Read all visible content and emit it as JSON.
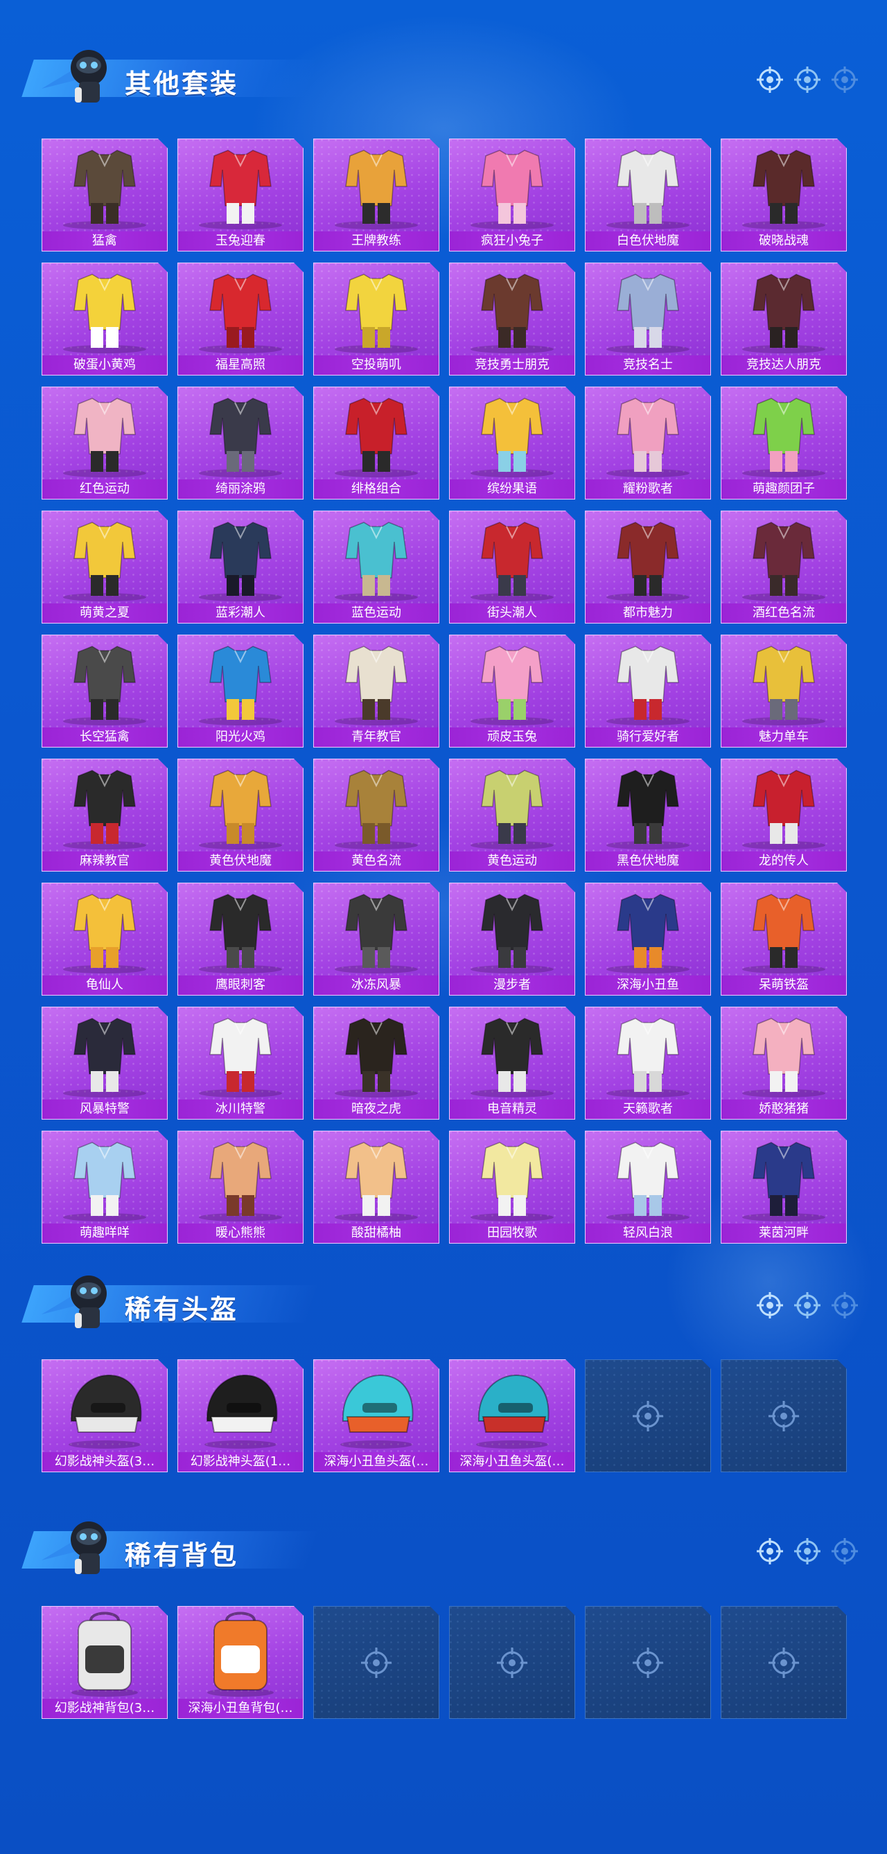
{
  "colors": {
    "background": "#0a5fd6",
    "card_purple": "#a342e3",
    "label_purple": "#9b24d6",
    "empty_slot": "#1f4b8e",
    "banner_blue": "#3fa8ff"
  },
  "sections": [
    {
      "title": "其他套装",
      "items": [
        {
          "label": "猛禽",
          "icon": "outfit-icon",
          "palette": [
            "#5b4a3a",
            "#3a2e26"
          ]
        },
        {
          "label": "玉兔迎春",
          "icon": "outfit-icon",
          "palette": [
            "#d8283a",
            "#f2f2f2"
          ]
        },
        {
          "label": "王牌教练",
          "icon": "outfit-icon",
          "palette": [
            "#e8a23a",
            "#2c2c2c"
          ]
        },
        {
          "label": "疯狂小兔子",
          "icon": "outfit-icon",
          "palette": [
            "#f07ab0",
            "#f4c6dc"
          ]
        },
        {
          "label": "白色伏地魔",
          "icon": "outfit-icon",
          "palette": [
            "#e8e8e8",
            "#bdbdbd"
          ]
        },
        {
          "label": "破晓战魂",
          "icon": "outfit-icon",
          "palette": [
            "#5a2a2a",
            "#2a2a2a"
          ]
        },
        {
          "label": "破蛋小黄鸡",
          "icon": "outfit-icon",
          "palette": [
            "#f4d23a",
            "#ffffff"
          ]
        },
        {
          "label": "福星高照",
          "icon": "outfit-icon",
          "palette": [
            "#d8282e",
            "#9a1a1f"
          ]
        },
        {
          "label": "空投萌叽",
          "icon": "outfit-icon",
          "palette": [
            "#f2d43e",
            "#c9a72a"
          ]
        },
        {
          "label": "竞技勇士朋克",
          "icon": "outfit-icon",
          "palette": [
            "#6b3a2e",
            "#3b2a26"
          ]
        },
        {
          "label": "竞技名士",
          "icon": "outfit-icon",
          "palette": [
            "#9aaed6",
            "#d8d8e8"
          ]
        },
        {
          "label": "竞技达人朋克",
          "icon": "outfit-icon",
          "palette": [
            "#5b2a30",
            "#2a2222"
          ]
        },
        {
          "label": "红色运动",
          "icon": "outfit-icon",
          "palette": [
            "#f0b4c4",
            "#2a2a2a"
          ]
        },
        {
          "label": "绮丽涂鸦",
          "icon": "outfit-icon",
          "palette": [
            "#3a3a4a",
            "#6a6a7a"
          ]
        },
        {
          "label": "绯格组合",
          "icon": "outfit-icon",
          "palette": [
            "#c8202a",
            "#2a2a2a"
          ]
        },
        {
          "label": "缤纷果语",
          "icon": "outfit-icon",
          "palette": [
            "#f4c03a",
            "#8ad0e6"
          ]
        },
        {
          "label": "耀粉歌者",
          "icon": "outfit-icon",
          "palette": [
            "#f0a0c0",
            "#e6c8d8"
          ]
        },
        {
          "label": "萌趣颜团子",
          "icon": "outfit-icon",
          "palette": [
            "#7ed04a",
            "#f2a0c0"
          ]
        },
        {
          "label": "萌黄之夏",
          "icon": "outfit-icon",
          "palette": [
            "#f2c83a",
            "#2a2a2a"
          ]
        },
        {
          "label": "蓝彩潮人",
          "icon": "outfit-icon",
          "palette": [
            "#2a3a5a",
            "#1a1a2a"
          ]
        },
        {
          "label": "蓝色运动",
          "icon": "outfit-icon",
          "palette": [
            "#4ac0d0",
            "#c8b890"
          ]
        },
        {
          "label": "街头潮人",
          "icon": "outfit-icon",
          "palette": [
            "#c8282e",
            "#3a3a4a"
          ]
        },
        {
          "label": "都市魅力",
          "icon": "outfit-icon",
          "palette": [
            "#8a2a2a",
            "#2a2a2a"
          ]
        },
        {
          "label": "酒红色名流",
          "icon": "outfit-icon",
          "palette": [
            "#6a2a3a",
            "#3a2a2a"
          ]
        },
        {
          "label": "长空猛禽",
          "icon": "outfit-icon",
          "palette": [
            "#4a4a4a",
            "#2a2a2a"
          ]
        },
        {
          "label": "阳光火鸡",
          "icon": "outfit-icon",
          "palette": [
            "#2a8ad8",
            "#f2c83a"
          ]
        },
        {
          "label": "青年教官",
          "icon": "outfit-icon",
          "palette": [
            "#e8e0d0",
            "#4a3a2a"
          ]
        },
        {
          "label": "顽皮玉兔",
          "icon": "outfit-icon",
          "palette": [
            "#f4a0c8",
            "#9ad06a"
          ]
        },
        {
          "label": "骑行爱好者",
          "icon": "outfit-icon",
          "palette": [
            "#e8e8e8",
            "#c8282e"
          ]
        },
        {
          "label": "魅力单车",
          "icon": "outfit-icon",
          "palette": [
            "#e8c03a",
            "#6a6a7a"
          ]
        },
        {
          "label": "麻辣教官",
          "icon": "outfit-icon",
          "palette": [
            "#2a2a2a",
            "#c8282e"
          ]
        },
        {
          "label": "黄色伏地魔",
          "icon": "outfit-icon",
          "palette": [
            "#e8a83a",
            "#c88a2a"
          ]
        },
        {
          "label": "黄色名流",
          "icon": "outfit-icon",
          "palette": [
            "#a8823a",
            "#7a5a2a"
          ]
        },
        {
          "label": "黄色运动",
          "icon": "outfit-icon",
          "palette": [
            "#c8d070",
            "#3a3a4a"
          ]
        },
        {
          "label": "黑色伏地魔",
          "icon": "outfit-icon",
          "palette": [
            "#1e1e1e",
            "#3a3a3a"
          ]
        },
        {
          "label": "龙的传人",
          "icon": "outfit-icon",
          "palette": [
            "#c8202e",
            "#e8e8e8"
          ]
        },
        {
          "label": "龟仙人",
          "icon": "outfit-icon",
          "palette": [
            "#f4c03a",
            "#e8a02a"
          ]
        },
        {
          "label": "鹰眼刺客",
          "icon": "outfit-icon",
          "palette": [
            "#2a2a2a",
            "#4a4a4a"
          ]
        },
        {
          "label": "冰冻风暴",
          "icon": "outfit-icon",
          "palette": [
            "#3a3a3a",
            "#5a5a5a"
          ]
        },
        {
          "label": "漫步者",
          "icon": "outfit-icon",
          "palette": [
            "#2a2a2e",
            "#3a3a3e"
          ]
        },
        {
          "label": "深海小丑鱼",
          "icon": "outfit-icon",
          "palette": [
            "#2a3a8a",
            "#e88a2a"
          ]
        },
        {
          "label": "呆萌铁盔",
          "icon": "outfit-icon",
          "palette": [
            "#e8602a",
            "#2a2a2a"
          ]
        },
        {
          "label": "风暴特警",
          "icon": "outfit-icon",
          "palette": [
            "#2a2a3a",
            "#e8e8e8"
          ]
        },
        {
          "label": "冰川特警",
          "icon": "outfit-icon",
          "palette": [
            "#f2f2f2",
            "#c8282e"
          ]
        },
        {
          "label": "暗夜之虎",
          "icon": "outfit-icon",
          "palette": [
            "#2a241e",
            "#3a3228"
          ]
        },
        {
          "label": "电音精灵",
          "icon": "outfit-icon",
          "palette": [
            "#2a2a2a",
            "#e8e8e8"
          ]
        },
        {
          "label": "天籁歌者",
          "icon": "outfit-icon",
          "palette": [
            "#f2f2f2",
            "#d8d8d8"
          ]
        },
        {
          "label": "娇憨猪猪",
          "icon": "outfit-icon",
          "palette": [
            "#f4b0c0",
            "#f2f2f2"
          ]
        },
        {
          "label": "萌趣咩咩",
          "icon": "outfit-icon",
          "palette": [
            "#a8d0f0",
            "#f2f2f2"
          ]
        },
        {
          "label": "暖心熊熊",
          "icon": "outfit-icon",
          "palette": [
            "#e8a87a",
            "#7a3a2a"
          ]
        },
        {
          "label": "酸甜橘柚",
          "icon": "outfit-icon",
          "palette": [
            "#f2c08a",
            "#f2f2f2"
          ]
        },
        {
          "label": "田园牧歌",
          "icon": "outfit-icon",
          "palette": [
            "#f2e8a0",
            "#f2f2f2"
          ]
        },
        {
          "label": "轻风白浪",
          "icon": "outfit-icon",
          "palette": [
            "#f2f2f2",
            "#a8c8e8"
          ]
        },
        {
          "label": "莱茵河畔",
          "icon": "outfit-icon",
          "palette": [
            "#2a3a8a",
            "#1e1e3a"
          ]
        }
      ]
    },
    {
      "title": "稀有头盔",
      "items": [
        {
          "label": "幻影战神头盔(3…",
          "icon": "helmet-icon",
          "palette": [
            "#2a2a2a",
            "#e8e8e8"
          ]
        },
        {
          "label": "幻影战神头盔(1…",
          "icon": "helmet-icon",
          "palette": [
            "#1e1e1e",
            "#f2f2f2"
          ]
        },
        {
          "label": "深海小丑鱼头盔(…",
          "icon": "helmet-icon",
          "palette": [
            "#3ac8d8",
            "#e8602a"
          ]
        },
        {
          "label": "深海小丑鱼头盔(…",
          "icon": "helmet-icon",
          "palette": [
            "#2ab0c8",
            "#c8302a"
          ]
        },
        {
          "label": "",
          "icon": "empty-slot-icon",
          "empty": true
        },
        {
          "label": "",
          "icon": "empty-slot-icon",
          "empty": true
        }
      ]
    },
    {
      "title": "稀有背包",
      "items": [
        {
          "label": "幻影战神背包(3…",
          "icon": "backpack-icon",
          "palette": [
            "#e8e8e8",
            "#3a3a3a"
          ]
        },
        {
          "label": "深海小丑鱼背包(…",
          "icon": "backpack-icon",
          "palette": [
            "#f07a2a",
            "#ffffff"
          ]
        },
        {
          "label": "",
          "icon": "empty-slot-icon",
          "empty": true
        },
        {
          "label": "",
          "icon": "empty-slot-icon",
          "empty": true
        },
        {
          "label": "",
          "icon": "empty-slot-icon",
          "empty": true
        },
        {
          "label": "",
          "icon": "empty-slot-icon",
          "empty": true
        }
      ]
    }
  ]
}
